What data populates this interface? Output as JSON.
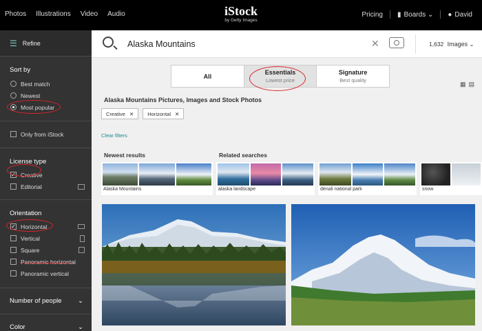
{
  "topnav": {
    "links": [
      "Photos",
      "Illustrations",
      "Video",
      "Audio"
    ],
    "logo_main": "iStock",
    "logo_sub": "by Getty Images",
    "pricing": "Pricing",
    "boards": "Boards",
    "user": "David"
  },
  "sidebar": {
    "refine": "Refine",
    "sort_by": {
      "title": "Sort by",
      "options": [
        "Best match",
        "Newest",
        "Most popular"
      ],
      "selected": "Most popular"
    },
    "only_istock": "Only from iStock",
    "license": {
      "title": "License type",
      "options": [
        "Creative",
        "Editorial"
      ],
      "checked": "Creative"
    },
    "orientation": {
      "title": "Orientation",
      "options": [
        "Horizontal",
        "Vertical",
        "Square",
        "Panoramic horizontal",
        "Panoramic vertical"
      ],
      "checked": "Horizontal"
    },
    "people": "Number of people",
    "color": "Color"
  },
  "search": {
    "query": "Alaska Mountains",
    "count": "1,632",
    "type": "Images"
  },
  "tabs": [
    {
      "title": "All",
      "sub": ""
    },
    {
      "title": "Essentials",
      "sub": "Lowest price"
    },
    {
      "title": "Signature",
      "sub": "Best quality"
    }
  ],
  "heading": "Alaska Mountains Pictures, Images and Stock Photos",
  "chips": [
    "Creative",
    "Horizontal"
  ],
  "clear_filters": "Clear filters",
  "newest": {
    "title": "Newest results",
    "label": "Alaska Mountains"
  },
  "related": {
    "title": "Related searches",
    "items": [
      "alaska landscape",
      "denali national park",
      "snow"
    ]
  },
  "colors": {
    "accent": "#1b8a8a",
    "annotation": "#d8262c"
  }
}
